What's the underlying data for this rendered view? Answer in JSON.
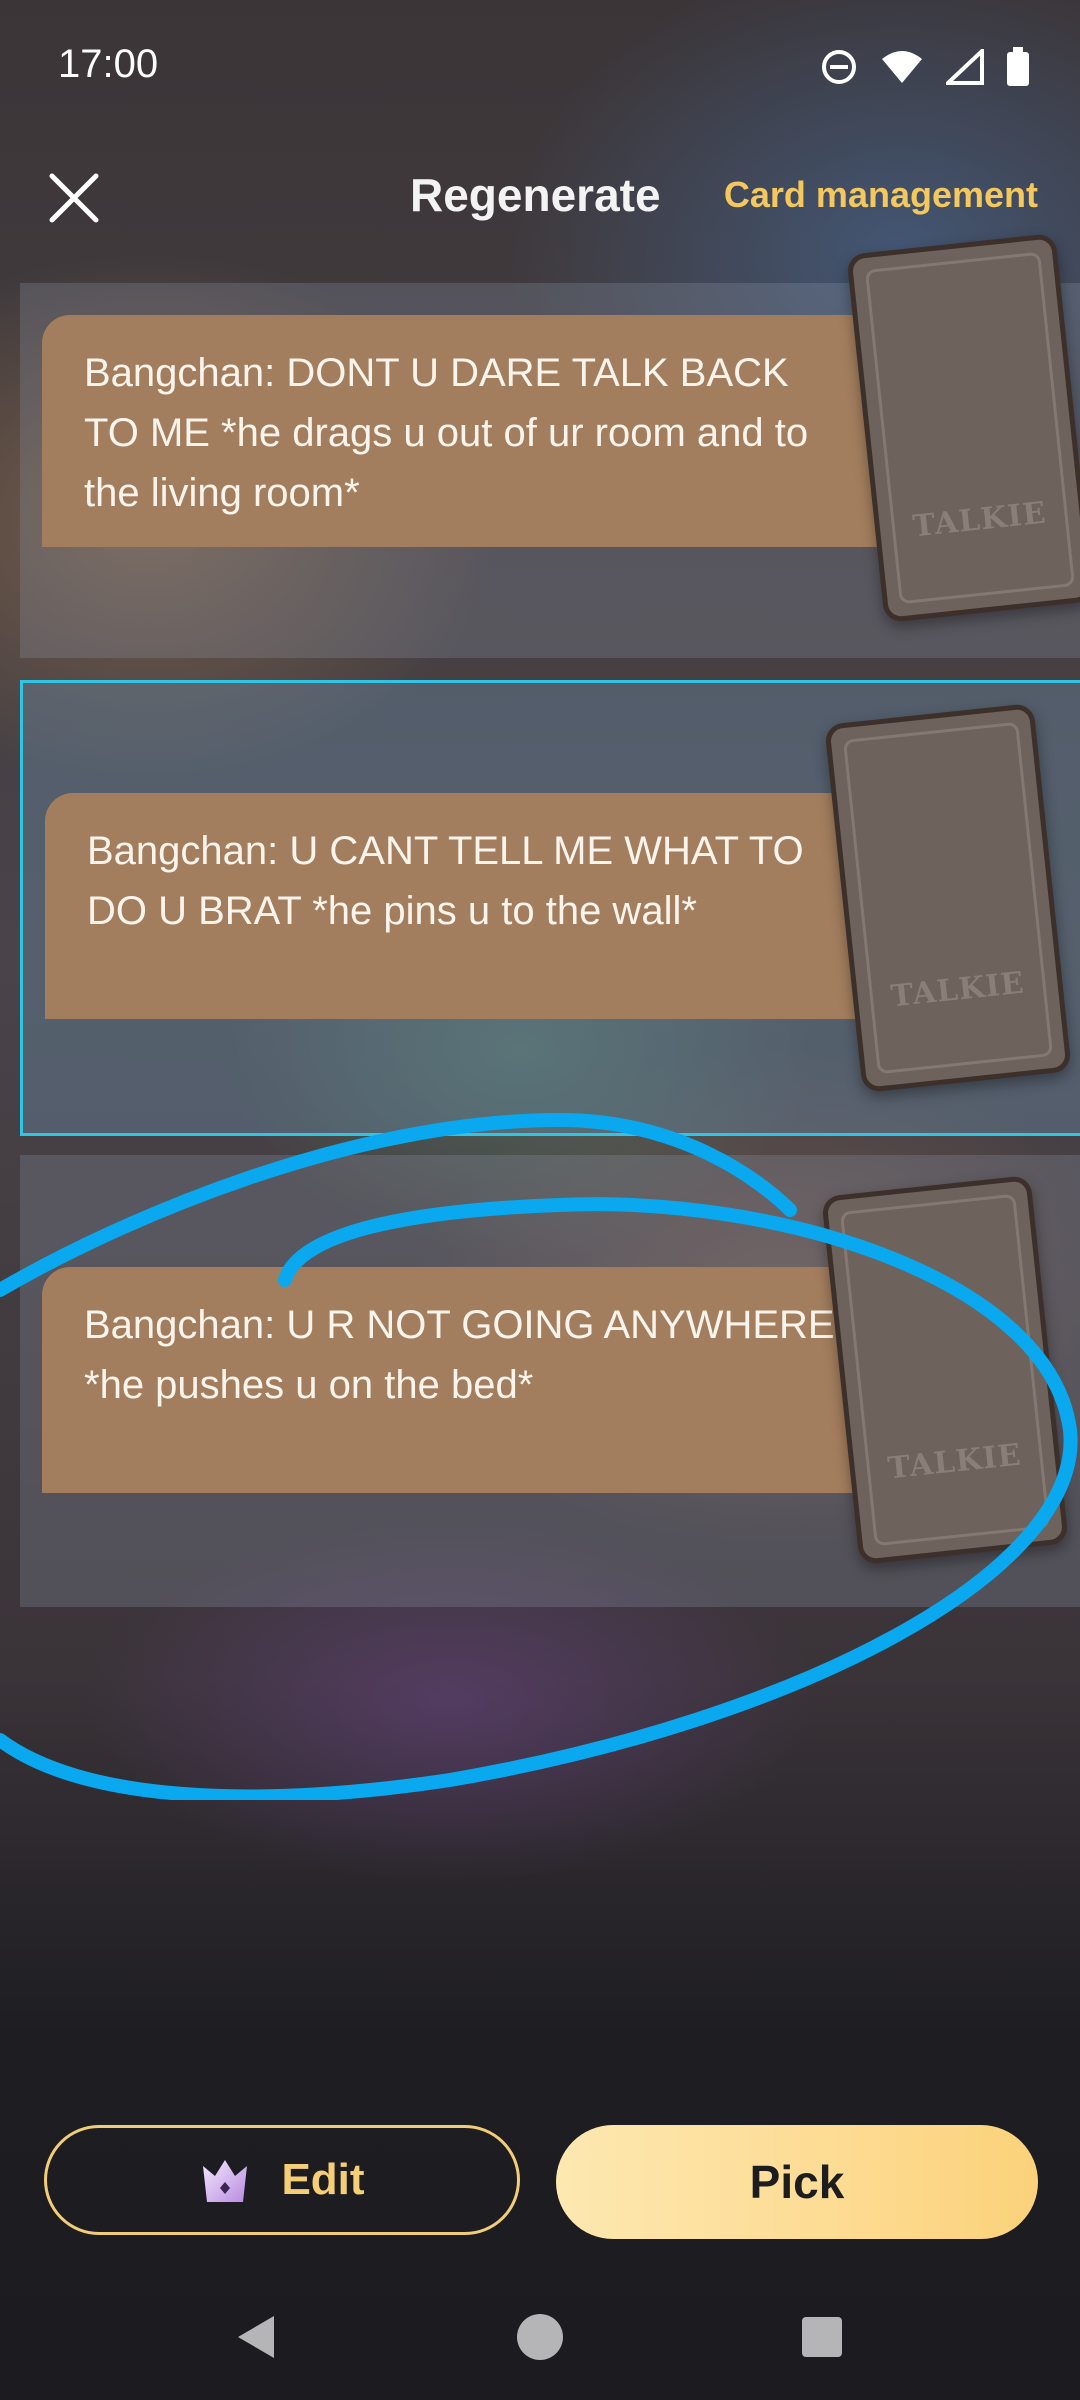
{
  "status_bar": {
    "time": "17:00"
  },
  "header": {
    "title": "Regenerate",
    "card_management": "Card management"
  },
  "options": [
    {
      "text": "Bangchan: DONT U DARE TALK BACK TO ME *he drags u out of ur room and to the living room*",
      "card_logo": "TALKIE",
      "selected": false
    },
    {
      "text": "Bangchan: U CANT TELL ME WHAT TO DO U BRAT *he pins u to the wall*",
      "card_logo": "TALKIE",
      "selected": true
    },
    {
      "text": "Bangchan: U R NOT GOING ANYWHERE *he pushes u on the bed*",
      "card_logo": "TALKIE",
      "selected": false
    }
  ],
  "actions": {
    "edit_label": "Edit",
    "pick_label": "Pick"
  },
  "colors": {
    "accent_gold": "#f5c85e",
    "selection_border": "#2ec6e4",
    "annotation": "#0aa8ee",
    "bubble": "#a37e5e"
  },
  "icons": [
    "close-icon",
    "do-not-disturb-icon",
    "wifi-icon",
    "signal-icon",
    "battery-icon",
    "crown-icon",
    "back-nav-icon",
    "home-nav-icon",
    "recents-nav-icon"
  ]
}
